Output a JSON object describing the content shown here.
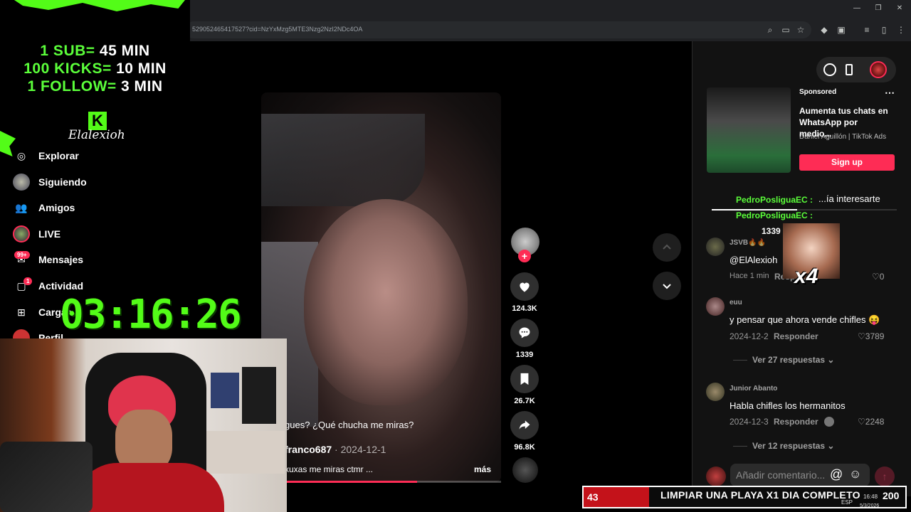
{
  "browser": {
    "url": "529052465417527?cid=NzYxMzg5MTE3Nzg2NzI2NDc4OA",
    "window_controls": [
      "minimize",
      "restore",
      "close"
    ]
  },
  "overlay": {
    "sub_lines": [
      {
        "label": "1 SUB=",
        "value": "45 MIN"
      },
      {
        "label": "100 KICKS=",
        "value": "10 MIN"
      },
      {
        "label": "1 FOLLOW=",
        "value": "3 MIN"
      }
    ],
    "logo_letter": "K",
    "signature": "Elalexioh",
    "timer": "03:16:26"
  },
  "sidebar": {
    "items": [
      {
        "label": "Explorar",
        "icon": "compass-icon"
      },
      {
        "label": "Siguiendo",
        "icon": "following-avatar-icon"
      },
      {
        "label": "Amigos",
        "icon": "friends-icon"
      },
      {
        "label": "LIVE",
        "icon": "live-icon"
      },
      {
        "label": "Mensajes",
        "icon": "messages-icon",
        "badge": "99+"
      },
      {
        "label": "Actividad",
        "icon": "activity-icon",
        "badge": "1"
      },
      {
        "label": "Cargar",
        "icon": "upload-icon"
      },
      {
        "label": "Perfil",
        "icon": "profile-icon"
      }
    ]
  },
  "video": {
    "caption_top": "gues? ¿Qué chucha me miras?",
    "author": "franco687",
    "date": " · 2024-12-1",
    "caption": "xuxas me miras ctmr ...",
    "more": "más",
    "progress": 0.65
  },
  "actions": {
    "likes": "124.3K",
    "comments": "1339",
    "saves": "26.7K",
    "shares": "96.8K"
  },
  "ad": {
    "sponsored": "Sponsored",
    "title": "Aumenta tus chats en WhatsApp por medio...",
    "meta": "Daniel Aguillón | TikTok Ads",
    "cta": "Sign up"
  },
  "comments_panel": {
    "tab_label": "...ía interesarte",
    "count": "1339",
    "chat_lines": [
      "PedroPosliguaEC :",
      "PedroPosliguaEC :"
    ],
    "comments": [
      {
        "user": "JSVB🔥🔥",
        "text": "@ElAlexioh",
        "meta": "Hace 1 min",
        "reply": "Responder",
        "likes": "0"
      },
      {
        "user": "euu",
        "text": "y pensar que ahora vende chifles 😝",
        "meta": "2024-12-2",
        "reply": "Responder",
        "likes": "3789",
        "view_replies": "Ver 27 respuestas"
      },
      {
        "user": "Junior Abanto",
        "text": "Habla chifles los hermanitos",
        "meta": "2024-12-3",
        "reply": "Responder",
        "likes": "2248",
        "view_replies": "Ver 12 respuestas"
      }
    ],
    "input_placeholder": "Añadir comentario...",
    "multiplier": "x4"
  },
  "goal_bar": {
    "left_value": "43",
    "text": "LIMPIAR UNA PLAYA X1 DIA COMPLETO",
    "right_value": "200"
  },
  "taskbar": {
    "lang": "ESP",
    "time": "16:48",
    "date": "5/3/2026"
  },
  "colors": {
    "tiktok_red": "#fe2c55",
    "kick_green": "#53fc18",
    "panel_bg": "#121212"
  }
}
